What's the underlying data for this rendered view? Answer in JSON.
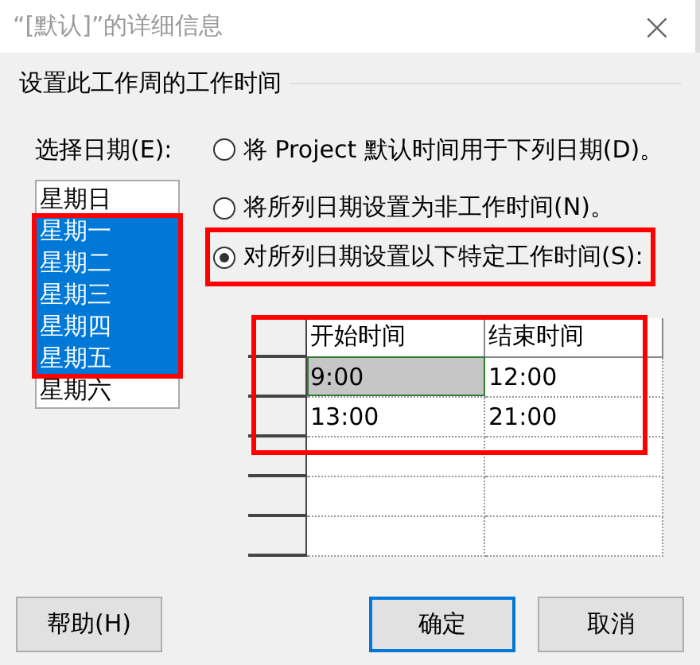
{
  "window": {
    "title": "“[默认]”的详细信息",
    "close": "×"
  },
  "heading": "设置此工作周的工作时间",
  "date_label": "选择日期(E):",
  "days_highlighted": true,
  "days": [
    {
      "label": "星期日",
      "selected": false
    },
    {
      "label": "星期一",
      "selected": true
    },
    {
      "label": "星期二",
      "selected": true
    },
    {
      "label": "星期三",
      "selected": true
    },
    {
      "label": "星期四",
      "selected": true
    },
    {
      "label": "星期五",
      "selected": true
    },
    {
      "label": "星期六",
      "selected": false
    }
  ],
  "options": [
    {
      "label": "将 Project 默认时间用于下列日期(D)。",
      "selected": false,
      "highlighted": false
    },
    {
      "label": "将所列日期设置为非工作时间(N)。",
      "selected": false,
      "highlighted": false
    },
    {
      "label": "对所列日期设置以下特定工作时间(S):",
      "selected": true,
      "highlighted": true
    }
  ],
  "grid": {
    "highlighted": true,
    "columns": [
      "开始时间",
      "结束时间"
    ],
    "rows": [
      {
        "cells": [
          {
            "text": "9:00",
            "selected": true
          },
          {
            "text": "12:00",
            "selected": false
          }
        ]
      },
      {
        "cells": [
          {
            "text": "13:00",
            "selected": false
          },
          {
            "text": "21:00",
            "selected": false
          }
        ]
      }
    ]
  },
  "buttons": [
    {
      "label": "帮助(H)",
      "default": false
    },
    {
      "label": "确定",
      "default": true
    },
    {
      "label": "取消",
      "default": false
    }
  ]
}
